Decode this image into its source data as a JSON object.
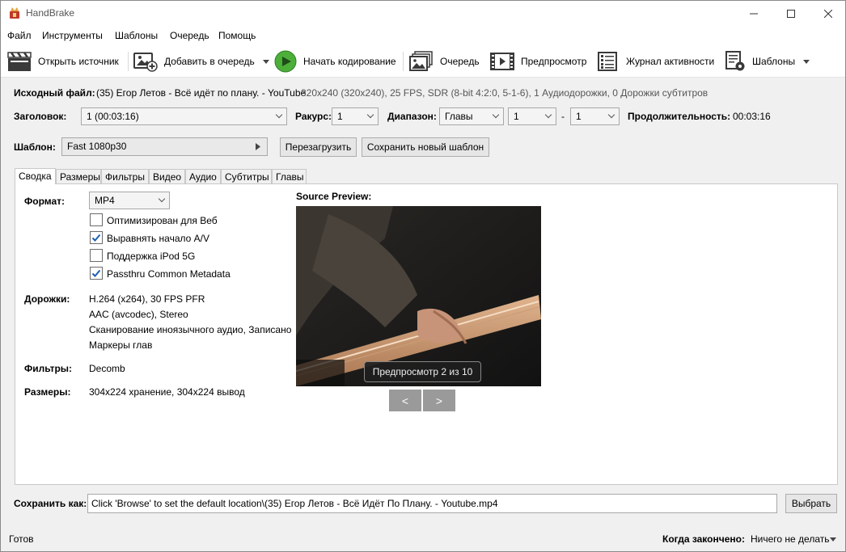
{
  "window": {
    "title": "HandBrake",
    "minimize": "—",
    "maximize": "☐",
    "close": "✕"
  },
  "menu": [
    "Файл",
    "Инструменты",
    "Шаблоны",
    "Очередь",
    "Помощь"
  ],
  "toolbar": {
    "open_source": "Открыть источник",
    "add_queue": "Добавить в очередь",
    "start": "Начать кодирование",
    "queue": "Очередь",
    "preview": "Предпросмотр",
    "activity_log": "Журнал активности",
    "presets": "Шаблоны"
  },
  "source": {
    "label": "Исходный файл:",
    "name": "(35) Егор Летов - Всё идёт по плану. - YouTube",
    "info": "320x240 (320x240), 25 FPS, SDR (8-bit 4:2:0, 5-1-6), 1 Аудиодорожки, 0 Дорожки субтитров"
  },
  "title_row": {
    "title_label": "Заголовок:",
    "title_value": "1  (00:03:16)",
    "angle_label": "Ракурс:",
    "angle_value": "1",
    "range_label": "Диапазон:",
    "range_type": "Главы",
    "range_start": "1",
    "range_dash": "-",
    "range_end": "1",
    "duration_label": "Продолжительность:",
    "duration_value": "00:03:16"
  },
  "preset_row": {
    "label": "Шаблон:",
    "value": "Fast 1080p30",
    "reload": "Перезагрузить",
    "save_new": "Сохранить новый шаблон"
  },
  "tabs": [
    "Сводка",
    "Размеры",
    "Фильтры",
    "Видео",
    "Аудио",
    "Субтитры",
    "Главы"
  ],
  "summary": {
    "format_label": "Формат:",
    "format_value": "MP4",
    "options": [
      {
        "label": "Оптимизирован для Веб",
        "checked": false
      },
      {
        "label": "Выравнять начало A/V",
        "checked": true
      },
      {
        "label": "Поддержка iPod 5G",
        "checked": false
      },
      {
        "label": "Passthru Common Metadata",
        "checked": true
      }
    ],
    "tracks_label": "Дорожки:",
    "tracks": [
      "H.264 (x264), 30 FPS PFR",
      "AAC (avcodec), Stereo",
      "Сканирование иноязычного аудио, Записано",
      "Маркеры глав"
    ],
    "filters_label": "Фильтры:",
    "filters_value": "Decomb",
    "size_label": "Размеры:",
    "size_value": "304x224 хранение, 304x224 вывод"
  },
  "preview": {
    "title": "Source Preview:",
    "counter": "Предпросмотр 2 из 10",
    "prev": "<",
    "next": ">"
  },
  "save_as": {
    "label": "Сохранить как:",
    "path": "Click 'Browse' to set the default location\\(35) Егор Летов - Всё Идёт По Плану. - Youtube.mp4",
    "browse": "Выбрать"
  },
  "status": {
    "state": "Готов",
    "when_done_label": "Когда закончено:",
    "when_done_value": "Ничего не делать"
  }
}
